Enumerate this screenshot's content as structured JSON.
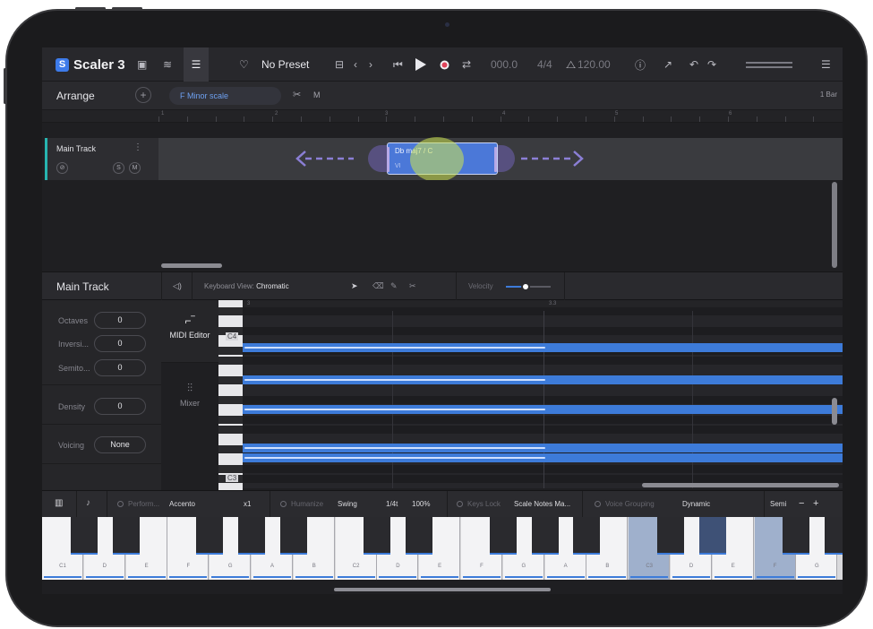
{
  "toolbar": {
    "app_name": "Scaler 3",
    "logo_letter": "S",
    "preset": "No Preset",
    "position": "000.0",
    "time_signature": "4/4",
    "tempo": "120.00"
  },
  "arrange": {
    "title": "Arrange",
    "scale": "F Minor scale",
    "m_label": "M",
    "bar_label": "1 Bar",
    "ruler_marks": [
      "1",
      "2",
      "3",
      "4",
      "5",
      "6"
    ]
  },
  "track": {
    "name": "Main Track",
    "menu": "⋮",
    "solo": "S",
    "mute": "M"
  },
  "chord": {
    "name": "Db maj7 / C",
    "degree": "VI"
  },
  "editor": {
    "title": "Main Track",
    "keyboard_view_label": "Keyboard View:",
    "keyboard_view_value": "Chromatic",
    "velocity_label": "Velocity",
    "ruler_marks": [
      "3",
      "3.3"
    ],
    "c4_label": "C4",
    "c3_label": "C3"
  },
  "controls": [
    {
      "label": "Octaves",
      "value": "0"
    },
    {
      "label": "Inversi...",
      "value": "0"
    },
    {
      "label": "Semito...",
      "value": "0"
    },
    {
      "label": "Density",
      "value": "0"
    },
    {
      "label": "Voicing",
      "value": "None"
    }
  ],
  "side_tabs": {
    "midi_editor": "MIDI Editor",
    "mixer": "Mixer"
  },
  "perf_bar": {
    "perform_label": "Perform...",
    "perform_value": "Accento",
    "multiplier": "x1",
    "humanize_label": "Humanize",
    "humanize_value": "Swing",
    "swing_division": "1/4t",
    "swing_amount": "100%",
    "keys_lock_label": "Keys Lock",
    "keys_lock_value": "Scale Notes Ma...",
    "voice_grouping_label": "Voice Grouping",
    "voice_grouping_value": "Dynamic",
    "semi_label": "Semi",
    "minus": "−",
    "plus": "+"
  },
  "piano": {
    "white_keys": [
      "C1",
      "D",
      "E",
      "F",
      "G",
      "A",
      "B",
      "C2",
      "D",
      "E",
      "F",
      "G",
      "A",
      "B",
      "C3",
      "D",
      "E",
      "F",
      "G"
    ]
  },
  "colors": {
    "accent_blue": "#3d7bd9",
    "track_teal": "#27b5b0",
    "scale_text": "#6ea0f0"
  }
}
